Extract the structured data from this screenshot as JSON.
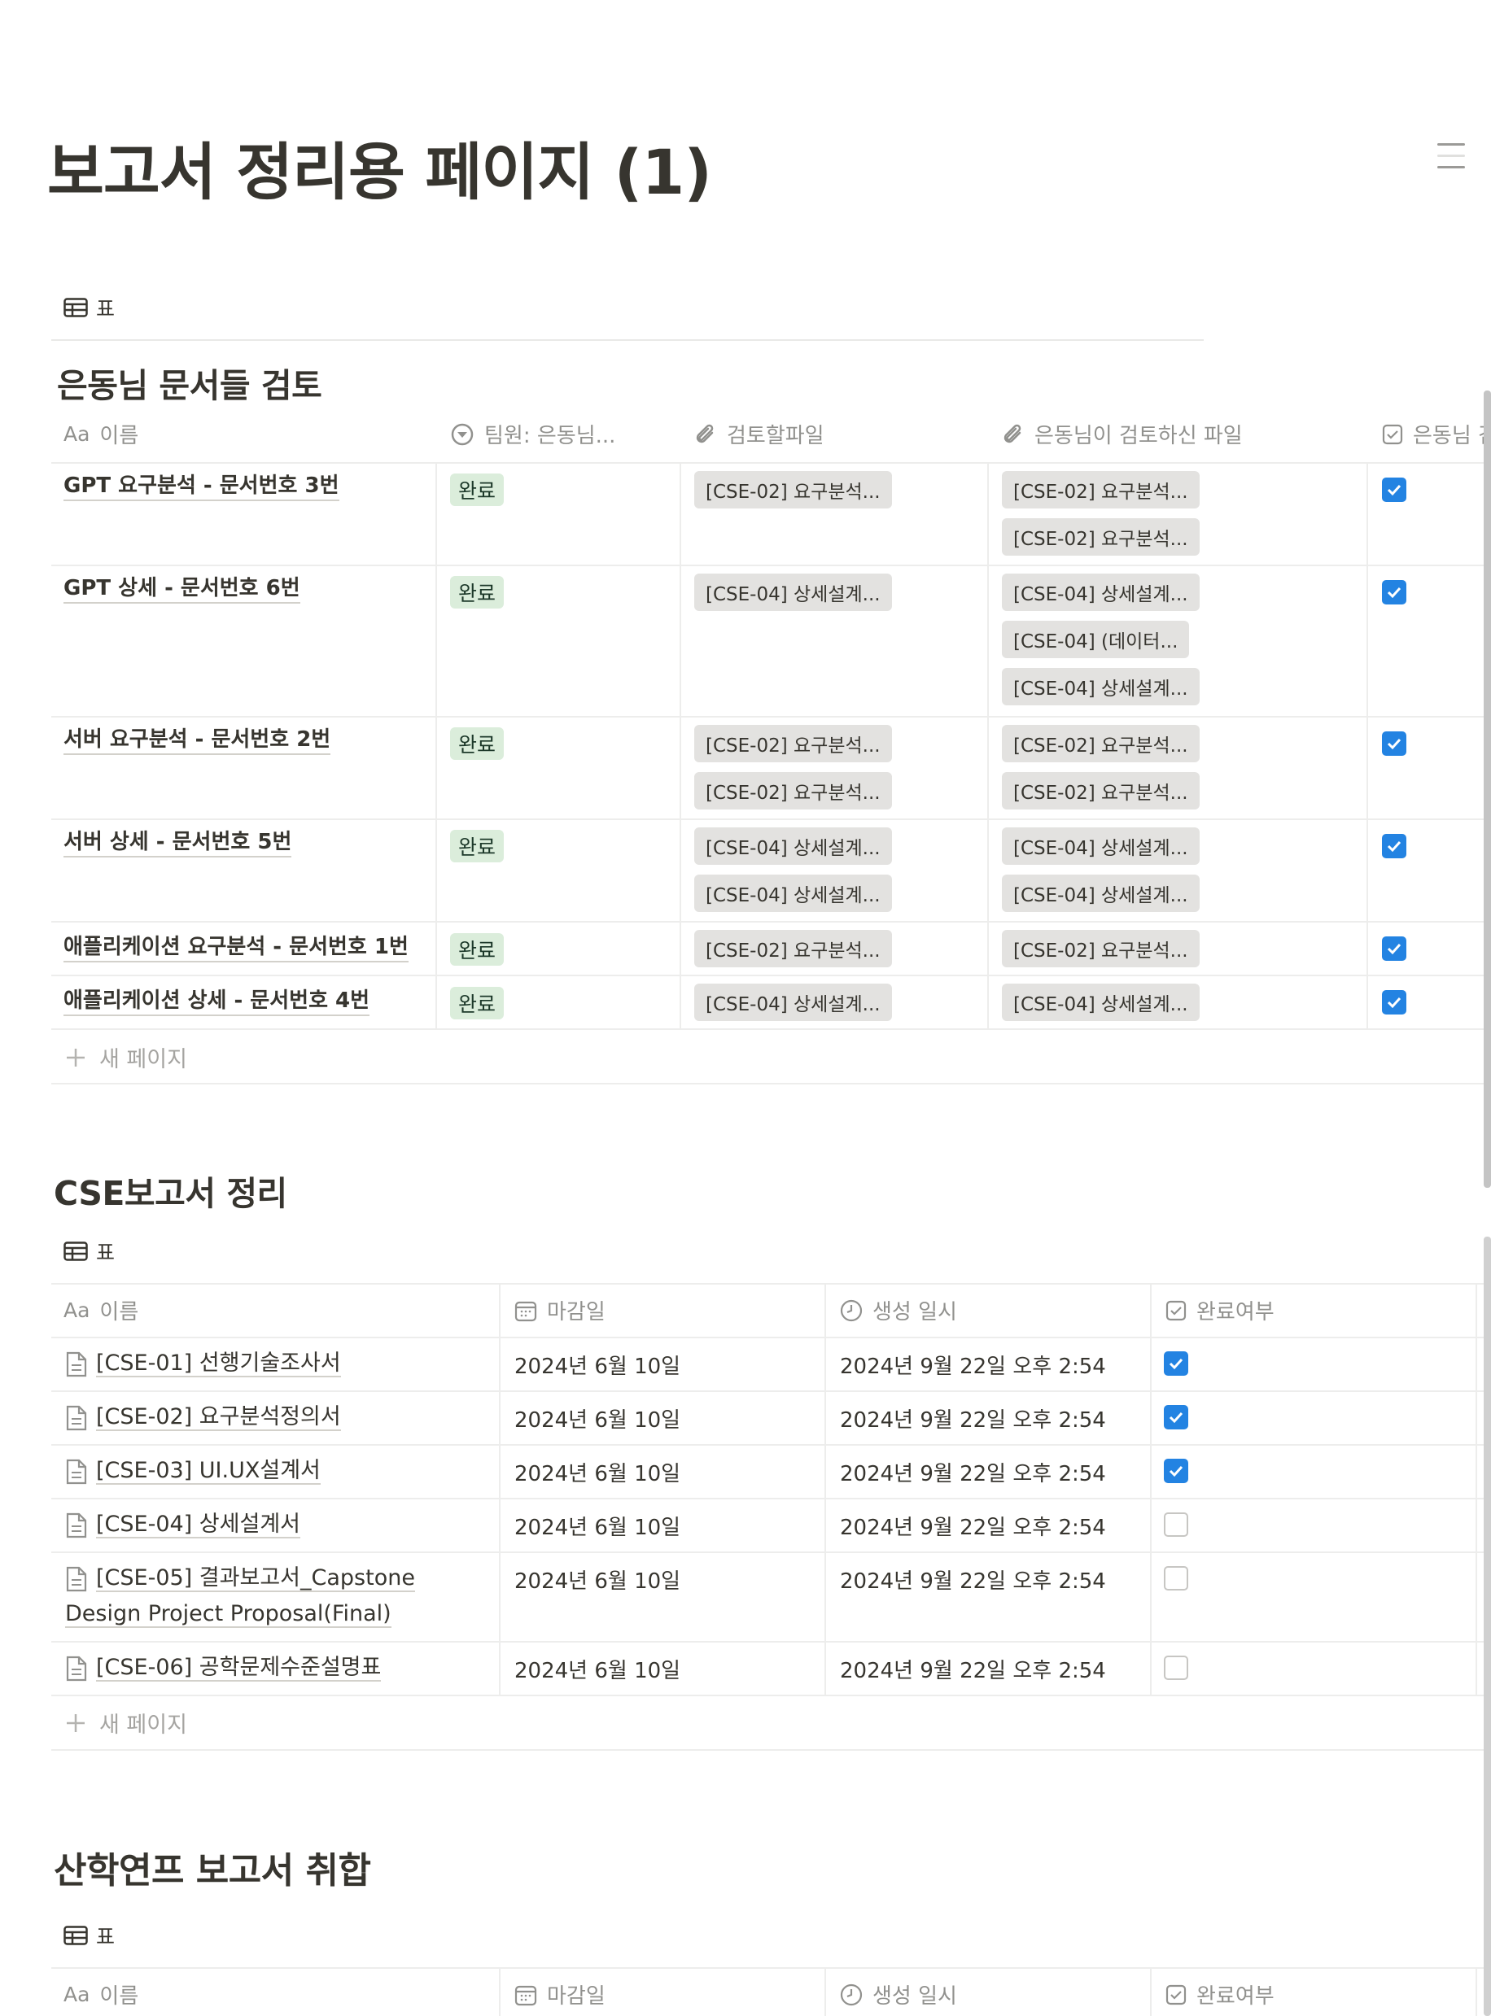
{
  "page": {
    "title": "보고서 정리용 페이지 (1)"
  },
  "db1": {
    "view_tab": "표",
    "title": "은동님 문서들 검토",
    "columns": {
      "name": "이름",
      "name_prefix": "Aa",
      "member": "팀원: 은동님...",
      "review_files": "검토할파일",
      "reviewed_files": "은동님이 검토하신 파일",
      "check": "은동님 검"
    },
    "rows": [
      {
        "name": "GPT 요구분석 - 문서번호 3번",
        "status": "완료",
        "files": [
          "[CSE-02] 요구분석..."
        ],
        "reviewed": [
          "[CSE-02] 요구분석...",
          "[CSE-02] 요구분석..."
        ],
        "checked": true
      },
      {
        "name": "GPT 상세 - 문서번호 6번",
        "status": "완료",
        "files": [
          "[CSE-04] 상세설계..."
        ],
        "reviewed": [
          "[CSE-04] 상세설계...",
          "[CSE-04] (데이터...",
          "[CSE-04] 상세설계..."
        ],
        "checked": true
      },
      {
        "name": "서버 요구분석 - 문서번호 2번",
        "status": "완료",
        "files": [
          "[CSE-02] 요구분석...",
          "[CSE-02] 요구분석..."
        ],
        "reviewed": [
          "[CSE-02] 요구분석...",
          "[CSE-02] 요구분석..."
        ],
        "checked": true
      },
      {
        "name": "서버 상세 - 문서번호 5번",
        "status": "완료",
        "files": [
          "[CSE-04] 상세설계...",
          "[CSE-04] 상세설계..."
        ],
        "reviewed": [
          "[CSE-04] 상세설계...",
          "[CSE-04] 상세설계..."
        ],
        "checked": true
      },
      {
        "name": "애플리케이션 요구분석 - 문서번호 1번",
        "status": "완료",
        "files": [
          "[CSE-02] 요구분석..."
        ],
        "reviewed": [
          "[CSE-02] 요구분석..."
        ],
        "checked": true
      },
      {
        "name": "애플리케이션 상세 - 문서번호 4번",
        "status": "완료",
        "files": [
          "[CSE-04] 상세설계..."
        ],
        "reviewed": [
          "[CSE-04] 상세설계..."
        ],
        "checked": true
      }
    ],
    "new_page": "새 페이지"
  },
  "db2": {
    "title": "CSE보고서 정리",
    "view_tab": "표",
    "columns": {
      "name_prefix": "Aa",
      "name": "이름",
      "due": "마감일",
      "created": "생성 일시",
      "done": "완료여부"
    },
    "rows": [
      {
        "name": "[CSE-01] 선행기술조사서",
        "due": "2024년 6월 10일",
        "created": "2024년 9월 22일 오후 2:54",
        "checked": true
      },
      {
        "name": "[CSE-02] 요구분석정의서",
        "due": "2024년 6월 10일",
        "created": "2024년 9월 22일 오후 2:54",
        "checked": true
      },
      {
        "name": "[CSE-03] UI.UX설계서",
        "due": "2024년 6월 10일",
        "created": "2024년 9월 22일 오후 2:54",
        "checked": true
      },
      {
        "name": "[CSE-04] 상세설계서",
        "due": "2024년 6월 10일",
        "created": "2024년 9월 22일 오후 2:54",
        "checked": false
      },
      {
        "name": "[CSE-05] 결과보고서_Capstone",
        "name2": "Design Project Proposal(Final)",
        "due": "2024년 6월 10일",
        "created": "2024년 9월 22일 오후 2:54",
        "checked": false
      },
      {
        "name": "[CSE-06] 공학문제수준설명표",
        "due": "2024년 6월 10일",
        "created": "2024년 9월 22일 오후 2:54",
        "checked": false
      }
    ],
    "new_page": "새 페이지"
  },
  "db3": {
    "title": "산학연프 보고서 취합",
    "view_tab": "표",
    "columns": {
      "name_prefix": "Aa",
      "name": "이름",
      "due": "마감일",
      "created": "생성 일시",
      "done": "완료여부"
    }
  },
  "colors": {
    "accent": "#2383e2",
    "done_tag_bg": "#dbeddb",
    "file_bg": "#e3e2e0"
  }
}
